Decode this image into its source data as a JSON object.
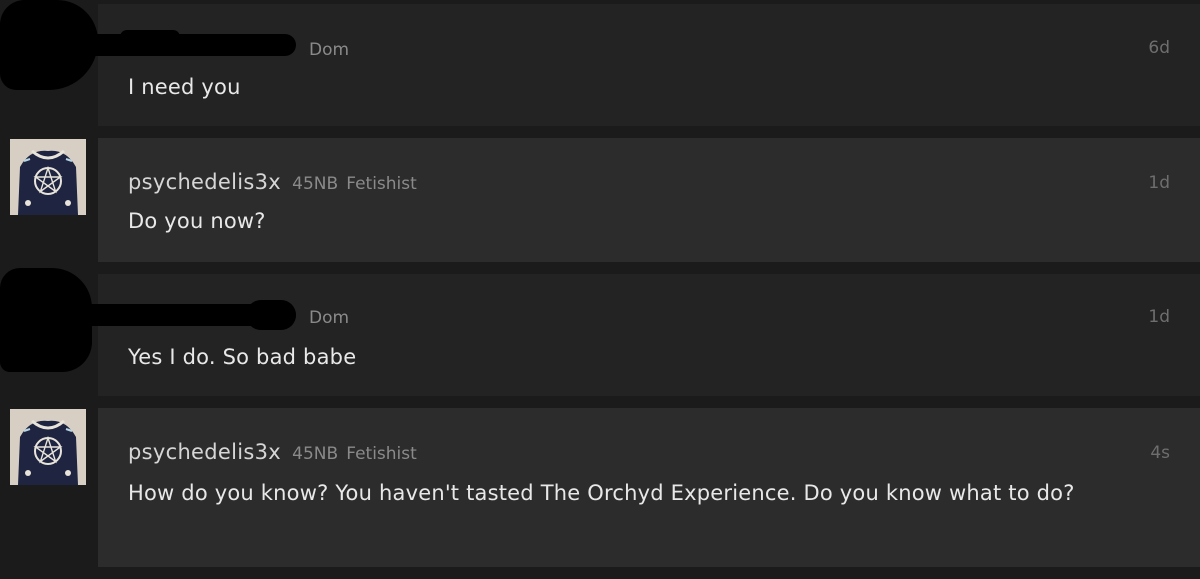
{
  "messages": [
    {
      "username": "",
      "age": "",
      "role": "Dom",
      "time": "6d",
      "text": "I need you"
    },
    {
      "username": "psychedelis3x",
      "age": "45NB",
      "role": "Fetishist",
      "time": "1d",
      "text": "Do you now?"
    },
    {
      "username": "",
      "age": "",
      "role": "Dom",
      "time": "1d",
      "text": "Yes I do. So bad babe"
    },
    {
      "username": "psychedelis3x",
      "age": "45NB",
      "role": "Fetishist",
      "time": "4s",
      "text": "How do you know? You haven't tasted The Orchyd Experience. Do you know what to do?"
    }
  ],
  "colors": {
    "page_bg": "#1b1b1b",
    "bubble_dark": "#232323",
    "bubble_light": "#2c2c2c",
    "redaction": "#000000",
    "username": "#d6d6d6",
    "muted": "#8a8a8a",
    "timestamp": "#6e6e6e",
    "body_text": "#e8e8e8"
  },
  "icons": {
    "avatar": "avatar-icon"
  }
}
